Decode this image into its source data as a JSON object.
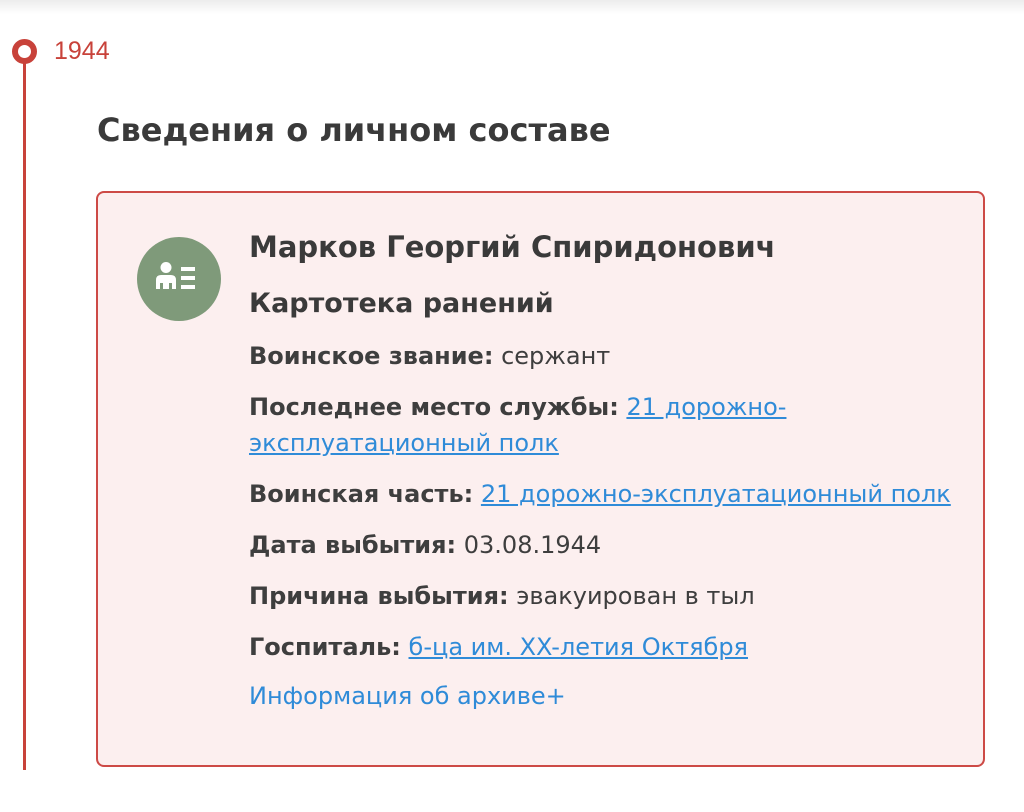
{
  "timeline": {
    "year": "1944"
  },
  "section": {
    "title": "Сведения о личном составе"
  },
  "record": {
    "name": "Марков Георгий Спиридонович",
    "type": "Картотека ранений",
    "avatar_icon": "person-card-icon",
    "fields": [
      {
        "label": "Воинское звание:",
        "value": "сержант",
        "is_link": false
      },
      {
        "label": "Последнее место службы:",
        "value": "21 дорожно-эксплуатационный полк",
        "is_link": true
      },
      {
        "label": "Воинская часть:",
        "value": "21 дорожно-эксплуатационный полк",
        "is_link": true
      },
      {
        "label": "Дата выбытия:",
        "value": "03.08.1944",
        "is_link": false
      },
      {
        "label": "Причина выбытия:",
        "value": "эвакуирован в тыл",
        "is_link": false
      },
      {
        "label": "Госпиталь:",
        "value": "б-ца им. XX-летия Октября",
        "is_link": true
      }
    ],
    "archive_link": "Информация об архиве+"
  },
  "colors": {
    "accent": "#c8423a",
    "card_background": "#fcefef",
    "link": "#2f8bd8",
    "avatar": "#7f9a7a"
  }
}
